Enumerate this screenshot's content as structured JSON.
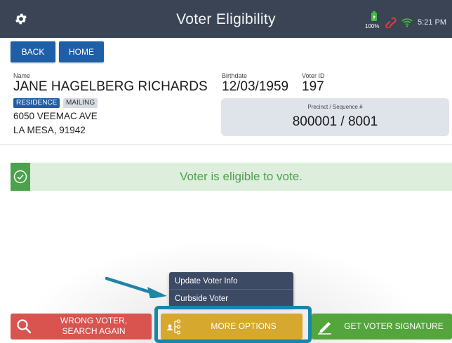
{
  "header": {
    "title": "Voter Eligibility",
    "battery_percent": "100%",
    "time": "5:21 PM",
    "colors": {
      "background": "#3a4454",
      "battery": "#3cbf3c",
      "link": "#e03c3c",
      "wifi": "#3cbf3c"
    }
  },
  "nav": {
    "back_label": "BACK",
    "home_label": "HOME"
  },
  "voter": {
    "name_label": "Name",
    "name": "JANE HAGELBERG RICHARDS",
    "birthdate_label": "Birthdate",
    "birthdate": "12/03/1959",
    "voter_id_label": "Voter ID",
    "voter_id": "197",
    "address_tabs": [
      "RESIDENCE",
      "MAILING"
    ],
    "address_line1": "6050 VEEMAC AVE",
    "address_line2": "LA MESA, 91942",
    "precinct_label": "Precinct / Sequence #",
    "precinct_value": "800001 / 8001"
  },
  "eligibility": {
    "message": "Voter is eligible to vote.",
    "color": "#4aa24a"
  },
  "menu": {
    "items": [
      "Update Voter Info",
      "Curbside Voter"
    ]
  },
  "actions": {
    "wrong_voter_line1": "WRONG VOTER,",
    "wrong_voter_line2": "SEARCH AGAIN",
    "more_options": "MORE OPTIONS",
    "get_signature": "GET VOTER SIGNATURE",
    "colors": {
      "wrong": "#d9534f",
      "more": "#d6a82e",
      "sign": "#53a53c",
      "highlight": "#1687a8"
    }
  }
}
